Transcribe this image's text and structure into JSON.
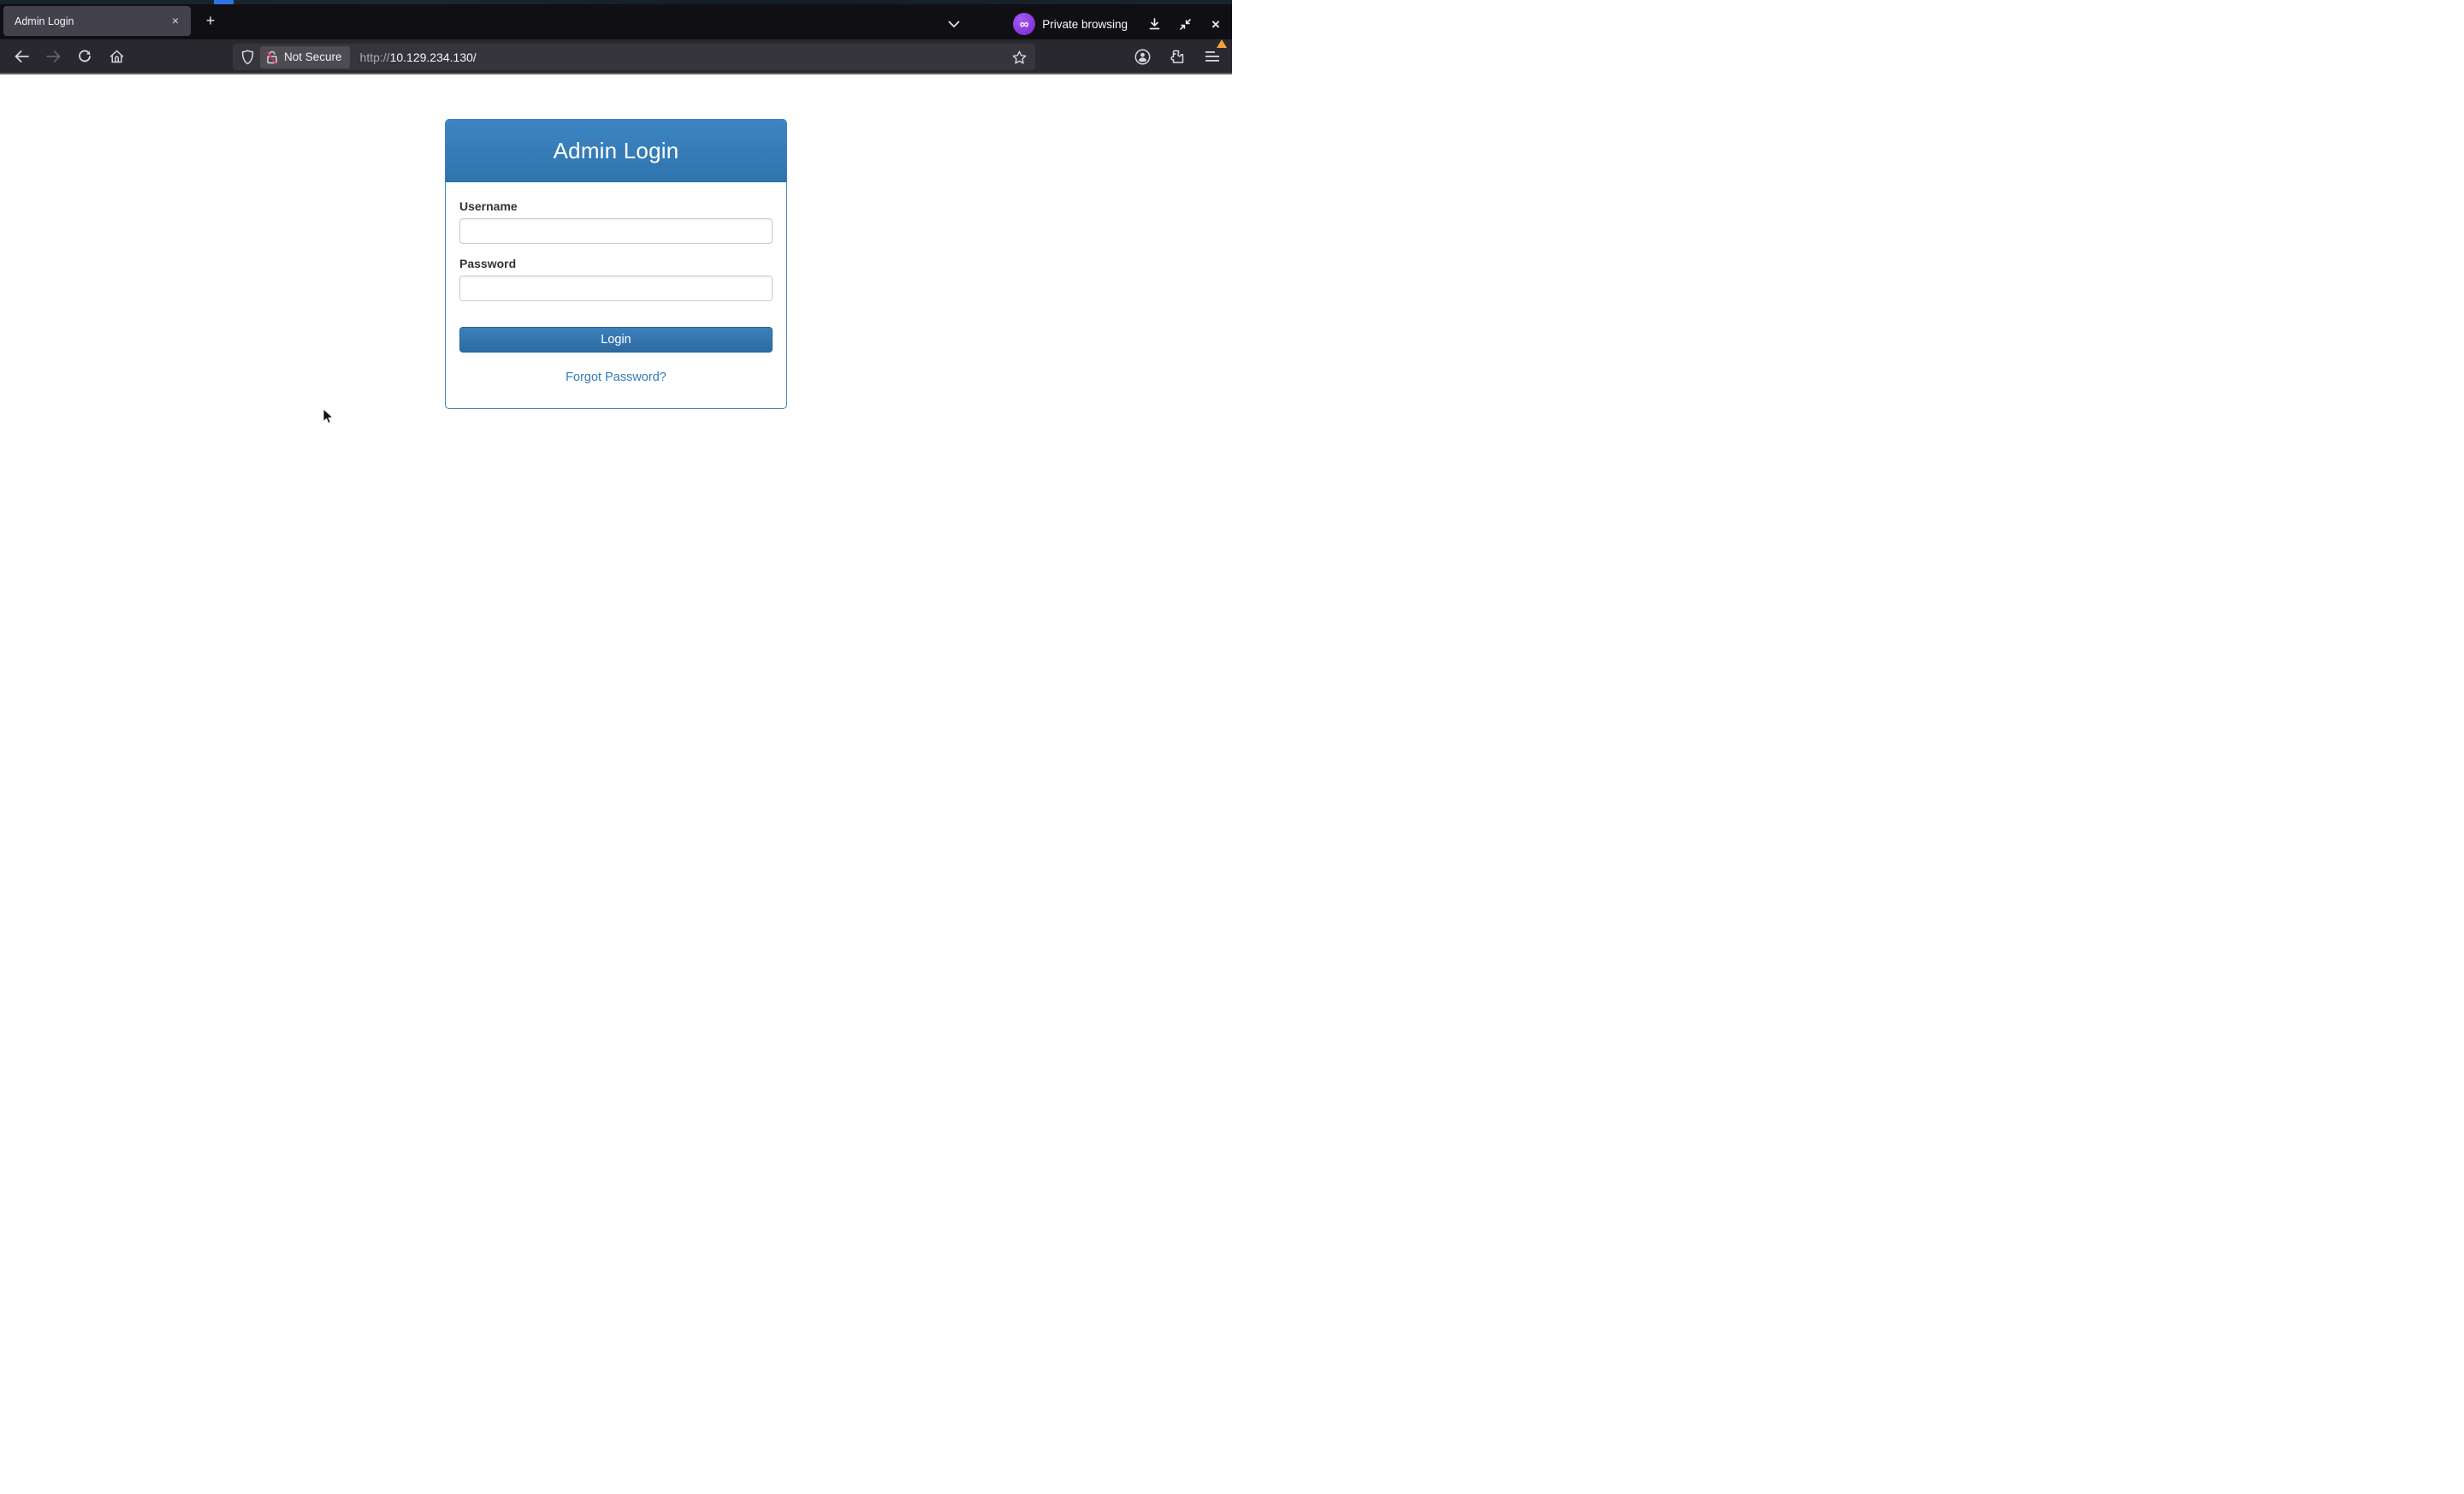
{
  "window": {
    "tab_title": "Admin Login",
    "tab_close_glyph": "×",
    "new_tab_glyph": "+",
    "private_badge_glyph": "∞",
    "private_label": "Private browsing",
    "window_close_glyph": "×"
  },
  "toolbar": {
    "security_chip_label": "Not Secure",
    "url_scheme": "http://",
    "url_host": "10.129.234.130/"
  },
  "login_page": {
    "card_title": "Admin Login",
    "username_label": "Username",
    "username_value": "",
    "password_label": "Password",
    "password_value": "",
    "login_button_label": "Login",
    "forgot_password_label": "Forgot Password?"
  },
  "colors": {
    "panel_header_blue": "#337ab7",
    "button_blue_top": "#3c80bc",
    "button_blue_bottom": "#2d6ba1",
    "link_blue": "#337ab7",
    "not_secure_slash_red": "#e22850",
    "private_purple": "#8f33d6",
    "menu_badge_orange": "#efa33c"
  }
}
